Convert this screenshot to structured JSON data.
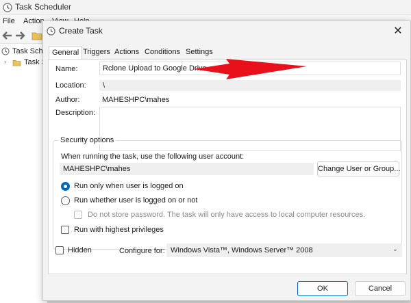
{
  "app": {
    "title": "Task Scheduler",
    "menu": [
      "File",
      "Action",
      "View",
      "Help"
    ],
    "tree": [
      "Task Scheduler (Local)",
      "Task Scheduler Library"
    ]
  },
  "dialog": {
    "title": "Create Task",
    "tabs": [
      "General",
      "Triggers",
      "Actions",
      "Conditions",
      "Settings"
    ],
    "active_tab": "General",
    "name_label": "Name:",
    "name_value": "Rclone Upload to Google Drive",
    "location_label": "Location:",
    "location_value": "\\",
    "author_label": "Author:",
    "author_value": "MAHESHPC\\mahes",
    "description_label": "Description:",
    "description_value": "",
    "security": {
      "group_title": "Security options",
      "account_prompt": "When running the task, use the following user account:",
      "account_value": "MAHESHPC\\mahes",
      "change_button": "Change User or Group...",
      "radio_logged_on": "Run only when user is logged on",
      "radio_logged_on_checked": true,
      "radio_whether": "Run whether user is logged on or not",
      "radio_whether_checked": false,
      "no_store_password": "Do not store password.  The task will only have access to local computer resources.",
      "highest_privileges": "Run with highest privileges"
    },
    "hidden_label": "Hidden",
    "configure_label": "Configure for:",
    "configure_value": "Windows Vista™, Windows Server™ 2008",
    "ok_button": "OK",
    "cancel_button": "Cancel"
  },
  "colors": {
    "accent": "#0067c0",
    "annotation_arrow": "#e8101a"
  },
  "icons": [
    "clock-icon",
    "close-icon",
    "back-arrow-icon",
    "forward-arrow-icon",
    "folder-icon",
    "chevron-right-icon",
    "chevron-down-icon"
  ]
}
